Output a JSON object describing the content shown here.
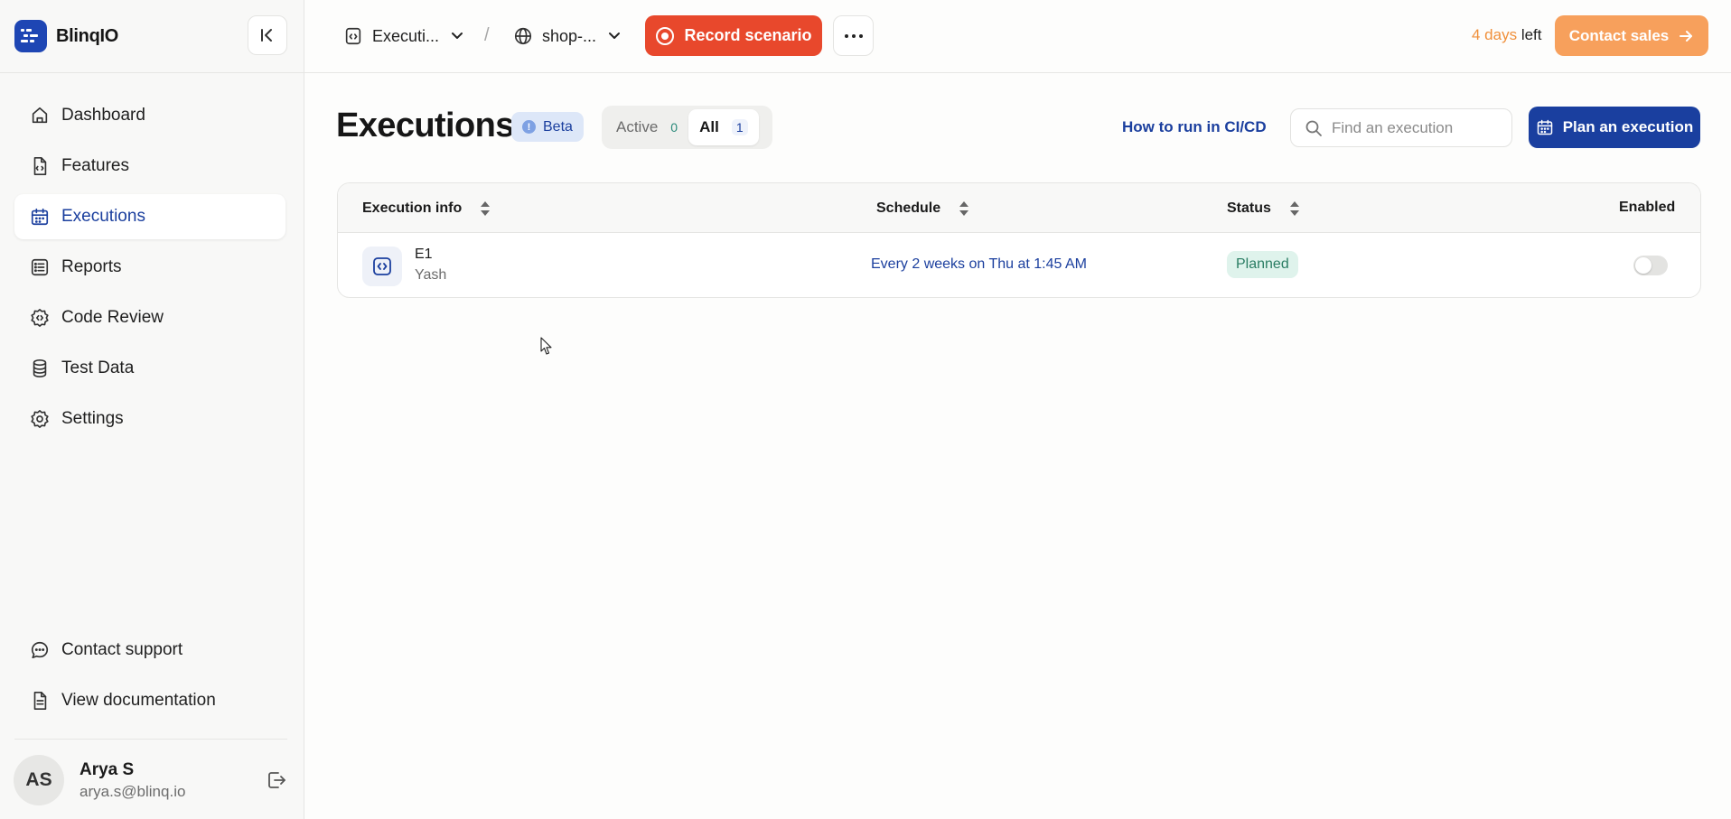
{
  "brand": {
    "name": "BlinqIO"
  },
  "sidebar": {
    "items": [
      {
        "label": "Dashboard",
        "icon": "home-icon",
        "active": false
      },
      {
        "label": "Features",
        "icon": "file-code-icon",
        "active": false
      },
      {
        "label": "Executions",
        "icon": "calendar-icon",
        "active": true
      },
      {
        "label": "Reports",
        "icon": "list-icon",
        "active": false
      },
      {
        "label": "Code Review",
        "icon": "gear-code-icon",
        "active": false
      },
      {
        "label": "Test Data",
        "icon": "database-icon",
        "active": false
      },
      {
        "label": "Settings",
        "icon": "gear-icon",
        "active": false
      }
    ],
    "bottom_items": [
      {
        "label": "Contact support",
        "icon": "chat-icon"
      },
      {
        "label": "View documentation",
        "icon": "document-icon"
      }
    ]
  },
  "user": {
    "initials": "AS",
    "name": "Arya S",
    "email": "arya.s@blinq.io"
  },
  "topbar": {
    "breadcrumb_project": "Executi...",
    "breadcrumb_separator": "/",
    "breadcrumb_site": "shop-...",
    "record_label": "Record scenario",
    "trial_days": "4 days",
    "trial_left": "left",
    "contact_sales_label": "Contact sales"
  },
  "page": {
    "title": "Executions",
    "beta_label": "Beta",
    "tabs": [
      {
        "label": "Active",
        "count": "0",
        "selected": false
      },
      {
        "label": "All",
        "count": "1",
        "selected": true
      }
    ],
    "cicd_link": "How to run in CI/CD",
    "search_placeholder": "Find an execution",
    "plan_label": "Plan an execution"
  },
  "table": {
    "columns": [
      "Execution info",
      "Schedule",
      "Status",
      "Enabled"
    ],
    "rows": [
      {
        "name": "E1",
        "owner": "Yash",
        "schedule": "Every 2 weeks on Thu at 1:45 AM",
        "status": "Planned",
        "enabled": false
      }
    ]
  },
  "colors": {
    "brand": "#1e46b4",
    "primary": "#1a3f9f",
    "record": "#e8482c",
    "sales": "#f7a05c",
    "status_planned": "#dff3ec"
  }
}
